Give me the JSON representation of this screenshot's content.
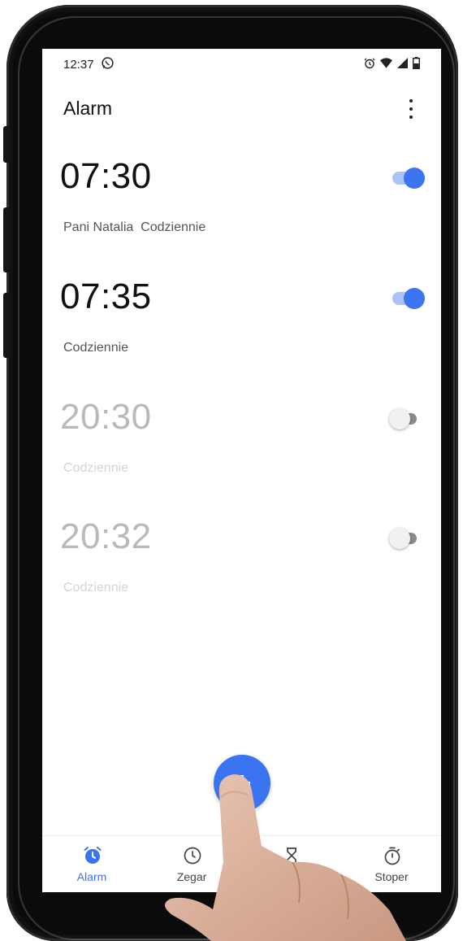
{
  "status_bar": {
    "time": "12:37",
    "icons": [
      "whatsapp-icon",
      "alarm-status-icon",
      "wifi-icon",
      "signal-icon",
      "battery-icon"
    ]
  },
  "header": {
    "title": "Alarm",
    "menu_icon": "more-vert-icon"
  },
  "alarms": [
    {
      "time": "07:30",
      "label": "Pani Natalia  Codziennie",
      "enabled": true
    },
    {
      "time": "07:35",
      "label": "Codziennie",
      "enabled": true
    },
    {
      "time": "20:30",
      "label": "Codziennie",
      "enabled": false
    },
    {
      "time": "20:32",
      "label": "Codziennie",
      "enabled": false
    }
  ],
  "fab": {
    "icon": "plus-icon"
  },
  "bottom_nav": {
    "items": [
      {
        "label": "Alarm",
        "icon": "alarm-icon",
        "active": true
      },
      {
        "label": "Zegar",
        "icon": "clock-icon",
        "active": false
      },
      {
        "label": "",
        "icon": "timer-icon",
        "active": false
      },
      {
        "label": "Stoper",
        "icon": "stopwatch-icon",
        "active": false
      }
    ]
  },
  "colors": {
    "accent": "#3b74f0",
    "toggle_track_on": "#a9c3f7",
    "text_primary": "#111111",
    "text_disabled": "#b9b9b9"
  }
}
